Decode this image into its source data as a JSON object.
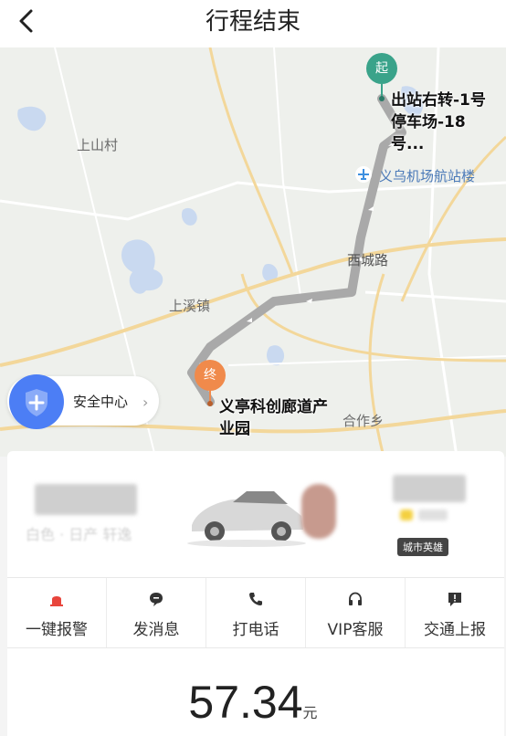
{
  "header": {
    "title": "行程结束"
  },
  "map": {
    "labels": {
      "shangshan": "上山村",
      "airport": "义乌机场航站楼",
      "xicheng": "西城路",
      "shangxi": "上溪镇",
      "hezuo": "合作乡"
    },
    "start": {
      "pin": "起",
      "address": "出站右转-1号停车场-18号..."
    },
    "end": {
      "pin": "终",
      "address": "义亭科创廊道产业园"
    }
  },
  "safety": {
    "label": "安全中心"
  },
  "driver": {
    "car_desc": "白色 · 日产 轩逸",
    "badge": "城市英雄"
  },
  "actions": [
    {
      "label": "一键报警",
      "icon": "alarm-icon"
    },
    {
      "label": "发消息",
      "icon": "message-icon"
    },
    {
      "label": "打电话",
      "icon": "phone-icon"
    },
    {
      "label": "VIP客服",
      "icon": "headset-icon"
    },
    {
      "label": "交通上报",
      "icon": "report-icon"
    }
  ],
  "fare": {
    "amount": "57.34",
    "unit": "元"
  },
  "colors": {
    "route": "#a9a9a9",
    "start": "#3aa38a",
    "end": "#f08a4b",
    "alarm": "#e8453c",
    "shield": "#4c7ef5"
  }
}
